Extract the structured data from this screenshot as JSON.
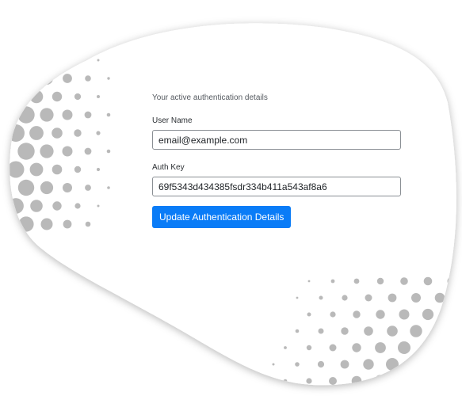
{
  "form": {
    "subtitle": "Your active authentication details",
    "user_name_label": "User Name",
    "user_name_value": "email@example.com",
    "auth_key_label": "Auth Key",
    "auth_key_value": "69f5343d434385fsdr334b411a543af8a6",
    "submit_label": "Update Authentication Details"
  },
  "colors": {
    "primary_button": "#0a7cf7",
    "dot_pattern": "#b9b9b9",
    "card_background": "#ffffff"
  }
}
